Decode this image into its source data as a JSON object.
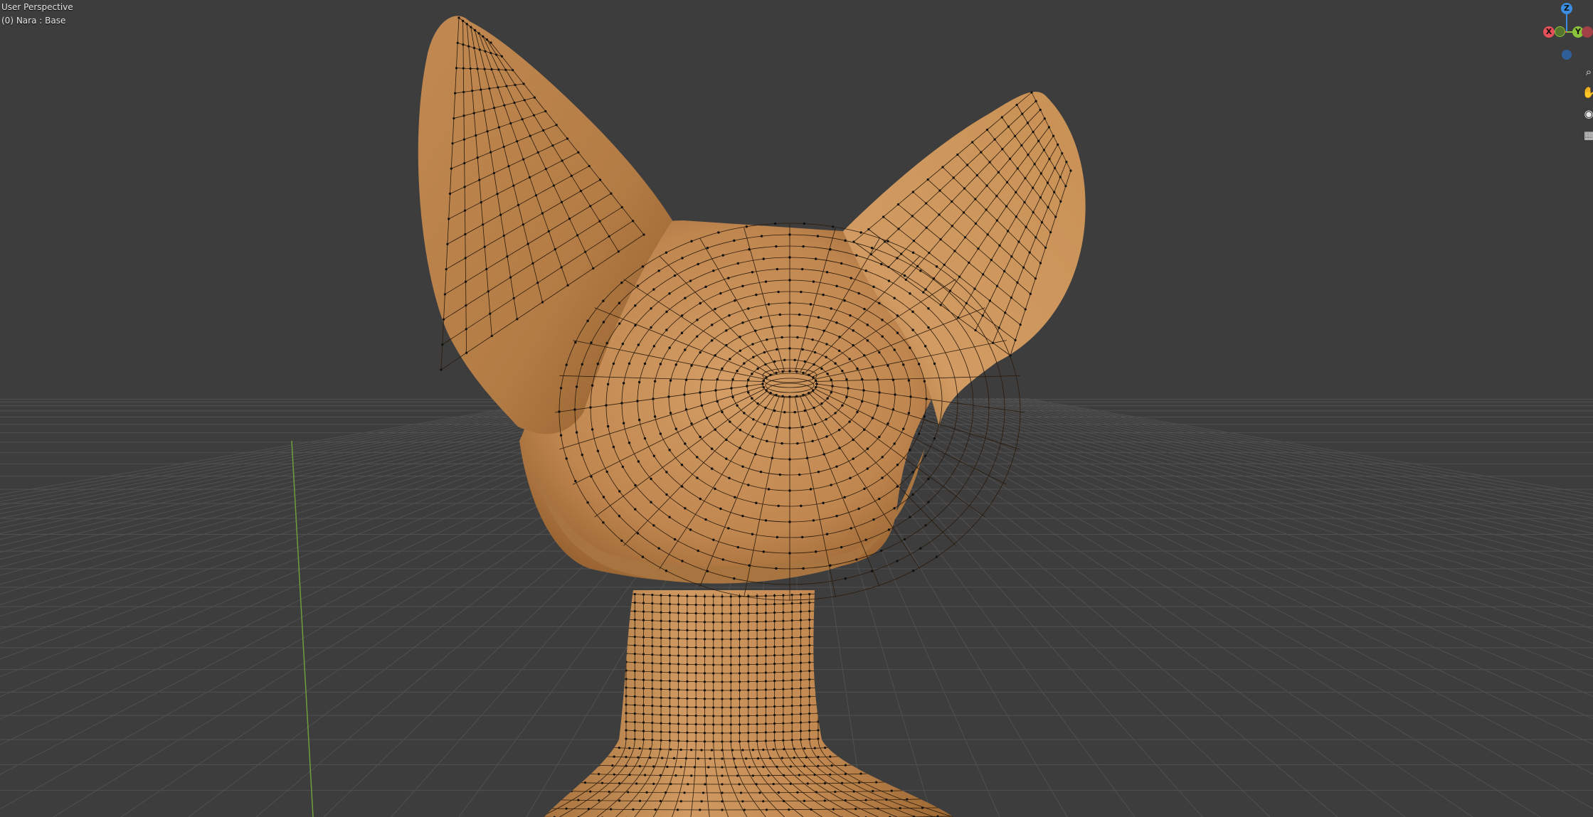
{
  "viewport": {
    "view_name": "User Perspective",
    "object_info": "(0) Nara : Base"
  },
  "gizmo": {
    "x_label": "X",
    "y_label": "Y",
    "z_label": "Z",
    "colors": {
      "x": "#e6505a",
      "y": "#8bc43a",
      "z": "#3b8de1"
    }
  },
  "nav_buttons": [
    {
      "name": "zoom",
      "icon": "magnifier-icon",
      "glyph": "⌕"
    },
    {
      "name": "pan",
      "icon": "hand-icon",
      "glyph": "✋"
    },
    {
      "name": "camera",
      "icon": "camera-icon",
      "glyph": "⌂"
    },
    {
      "name": "perspective",
      "icon": "grid-icon",
      "glyph": "▦"
    }
  ],
  "scene": {
    "background": "#3d3d3d",
    "grid_color": "#505050",
    "y_axis_line_color": "#6e9e3a",
    "mesh_color": "#c98f55",
    "wire_color": "#2a1a0c",
    "vertex_color": "#111111"
  }
}
